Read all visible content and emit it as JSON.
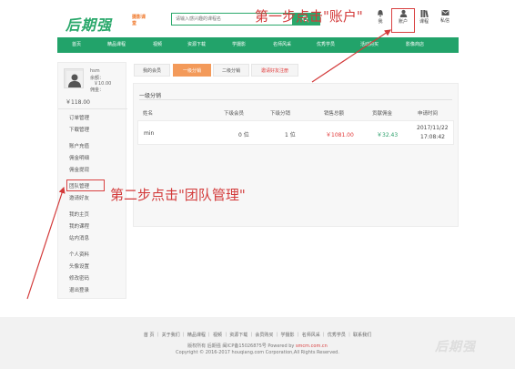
{
  "header": {
    "logo_text": "后期强",
    "logo_sub": "摄影课堂",
    "search_placeholder": "请输入感兴趣的课程名",
    "toolbar": [
      {
        "label": "我",
        "icon": "bell-icon"
      },
      {
        "label": "账户",
        "icon": "user-icon"
      },
      {
        "label": "课程",
        "icon": "books-icon"
      },
      {
        "label": "私信",
        "icon": "mail-icon"
      }
    ]
  },
  "nav": [
    "首页",
    "精品课程",
    "视频",
    "资源下载",
    "学摄影",
    "名师风采",
    "优秀学员",
    "活动购买",
    "影像商店"
  ],
  "user": {
    "name": "hsm",
    "balance_label": "余额：",
    "balance_value": "￥10.00",
    "commission_label": "佣金：",
    "total": "￥118.00"
  },
  "sidebar": {
    "items": [
      "订单管理",
      "下载管理",
      "账户充值",
      "佣金明细",
      "佣金提现",
      "团队管理",
      "邀请好友",
      "我的主页",
      "我的课程",
      "站内消息",
      "个人资料",
      "头像设置",
      "修改密码",
      "退出登录"
    ]
  },
  "tabs": [
    "我的会员",
    "一级分销",
    "二级分销",
    "邀请好友注册"
  ],
  "panel": {
    "title": "一级分销",
    "columns": [
      "姓名",
      "下级会员",
      "下级分销",
      "销售总额",
      "贡献佣金",
      "申请时间"
    ],
    "row": {
      "name": "min",
      "members": "0 位",
      "distributors": "1 位",
      "sales": "￥1081.00",
      "commission": "￥32.43",
      "date": "2017/11/22",
      "time": "17:08:42"
    }
  },
  "annotations": {
    "step1": "第一步点击\"账户\"",
    "step2": "第二步点击\"团队管理\""
  },
  "footer": {
    "links": "首 页 ｜ 关于我们 ｜ 精品课程 ｜ 视频 ｜ 资源下载 ｜ 会员购买 ｜ 学摄影 ｜ 名师风采 ｜ 优秀学员 ｜ 联系我们",
    "icp": "版权所有 后期强 闽ICP备15026875号 Powered by",
    "powered": "smcm.com.cn",
    "copyright": "Copyright © 2016-2017 houqiang.com Corporation,All Rights Reserved.",
    "logo": "后期强"
  },
  "colors": {
    "brand_green": "#22a36a",
    "accent_orange": "#f39a5a",
    "annotation_red": "#d33a3a"
  }
}
